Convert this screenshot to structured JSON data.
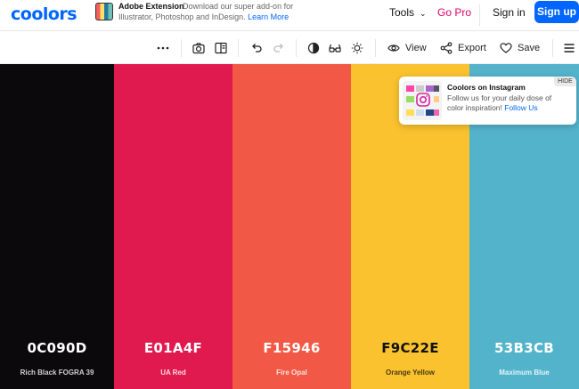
{
  "header": {
    "logo": "coolors",
    "extension": {
      "title": "Adobe Extension",
      "desc_line1": "Download our super add-on for",
      "desc_line2": "Illustrator, Photoshop and InDesign.",
      "link": "Learn More"
    },
    "nav": {
      "tools": "Tools",
      "go_pro": "Go Pro",
      "sign_in": "Sign in",
      "sign_up": "Sign up"
    }
  },
  "toolbar": {
    "view_label": "View",
    "export_label": "Export",
    "save_label": "Save"
  },
  "palette": [
    {
      "hex": "0C090D",
      "name": "Rich Black FOGRA 39",
      "color": "#0C090D",
      "text_color": "#ffffff",
      "name_color": "#cfcfcf"
    },
    {
      "hex": "E01A4F",
      "name": "UA Red",
      "color": "#E01A4F",
      "text_color": "#ffffff",
      "name_color": "#ffd7e1"
    },
    {
      "hex": "F15946",
      "name": "Fire Opal",
      "color": "#F15946",
      "text_color": "#ffffff",
      "name_color": "#ffe0da"
    },
    {
      "hex": "F9C22E",
      "name": "Orange Yellow",
      "color": "#F9C22E",
      "text_color": "#111111",
      "name_color": "#4a3a10"
    },
    {
      "hex": "53B3CB",
      "name": "Maximum Blue",
      "color": "#53B3CB",
      "text_color": "#ffffff",
      "name_color": "#e2f5fa"
    }
  ],
  "popup": {
    "hide_label": "HIDE",
    "title": "Coolors on Instagram",
    "body_line1": "Follow us for your daily dose of",
    "body_line2": "color inspiration!",
    "link": "Follow Us"
  },
  "colors": {
    "brand": "#0066ff",
    "go_pro": "#e0006d"
  }
}
